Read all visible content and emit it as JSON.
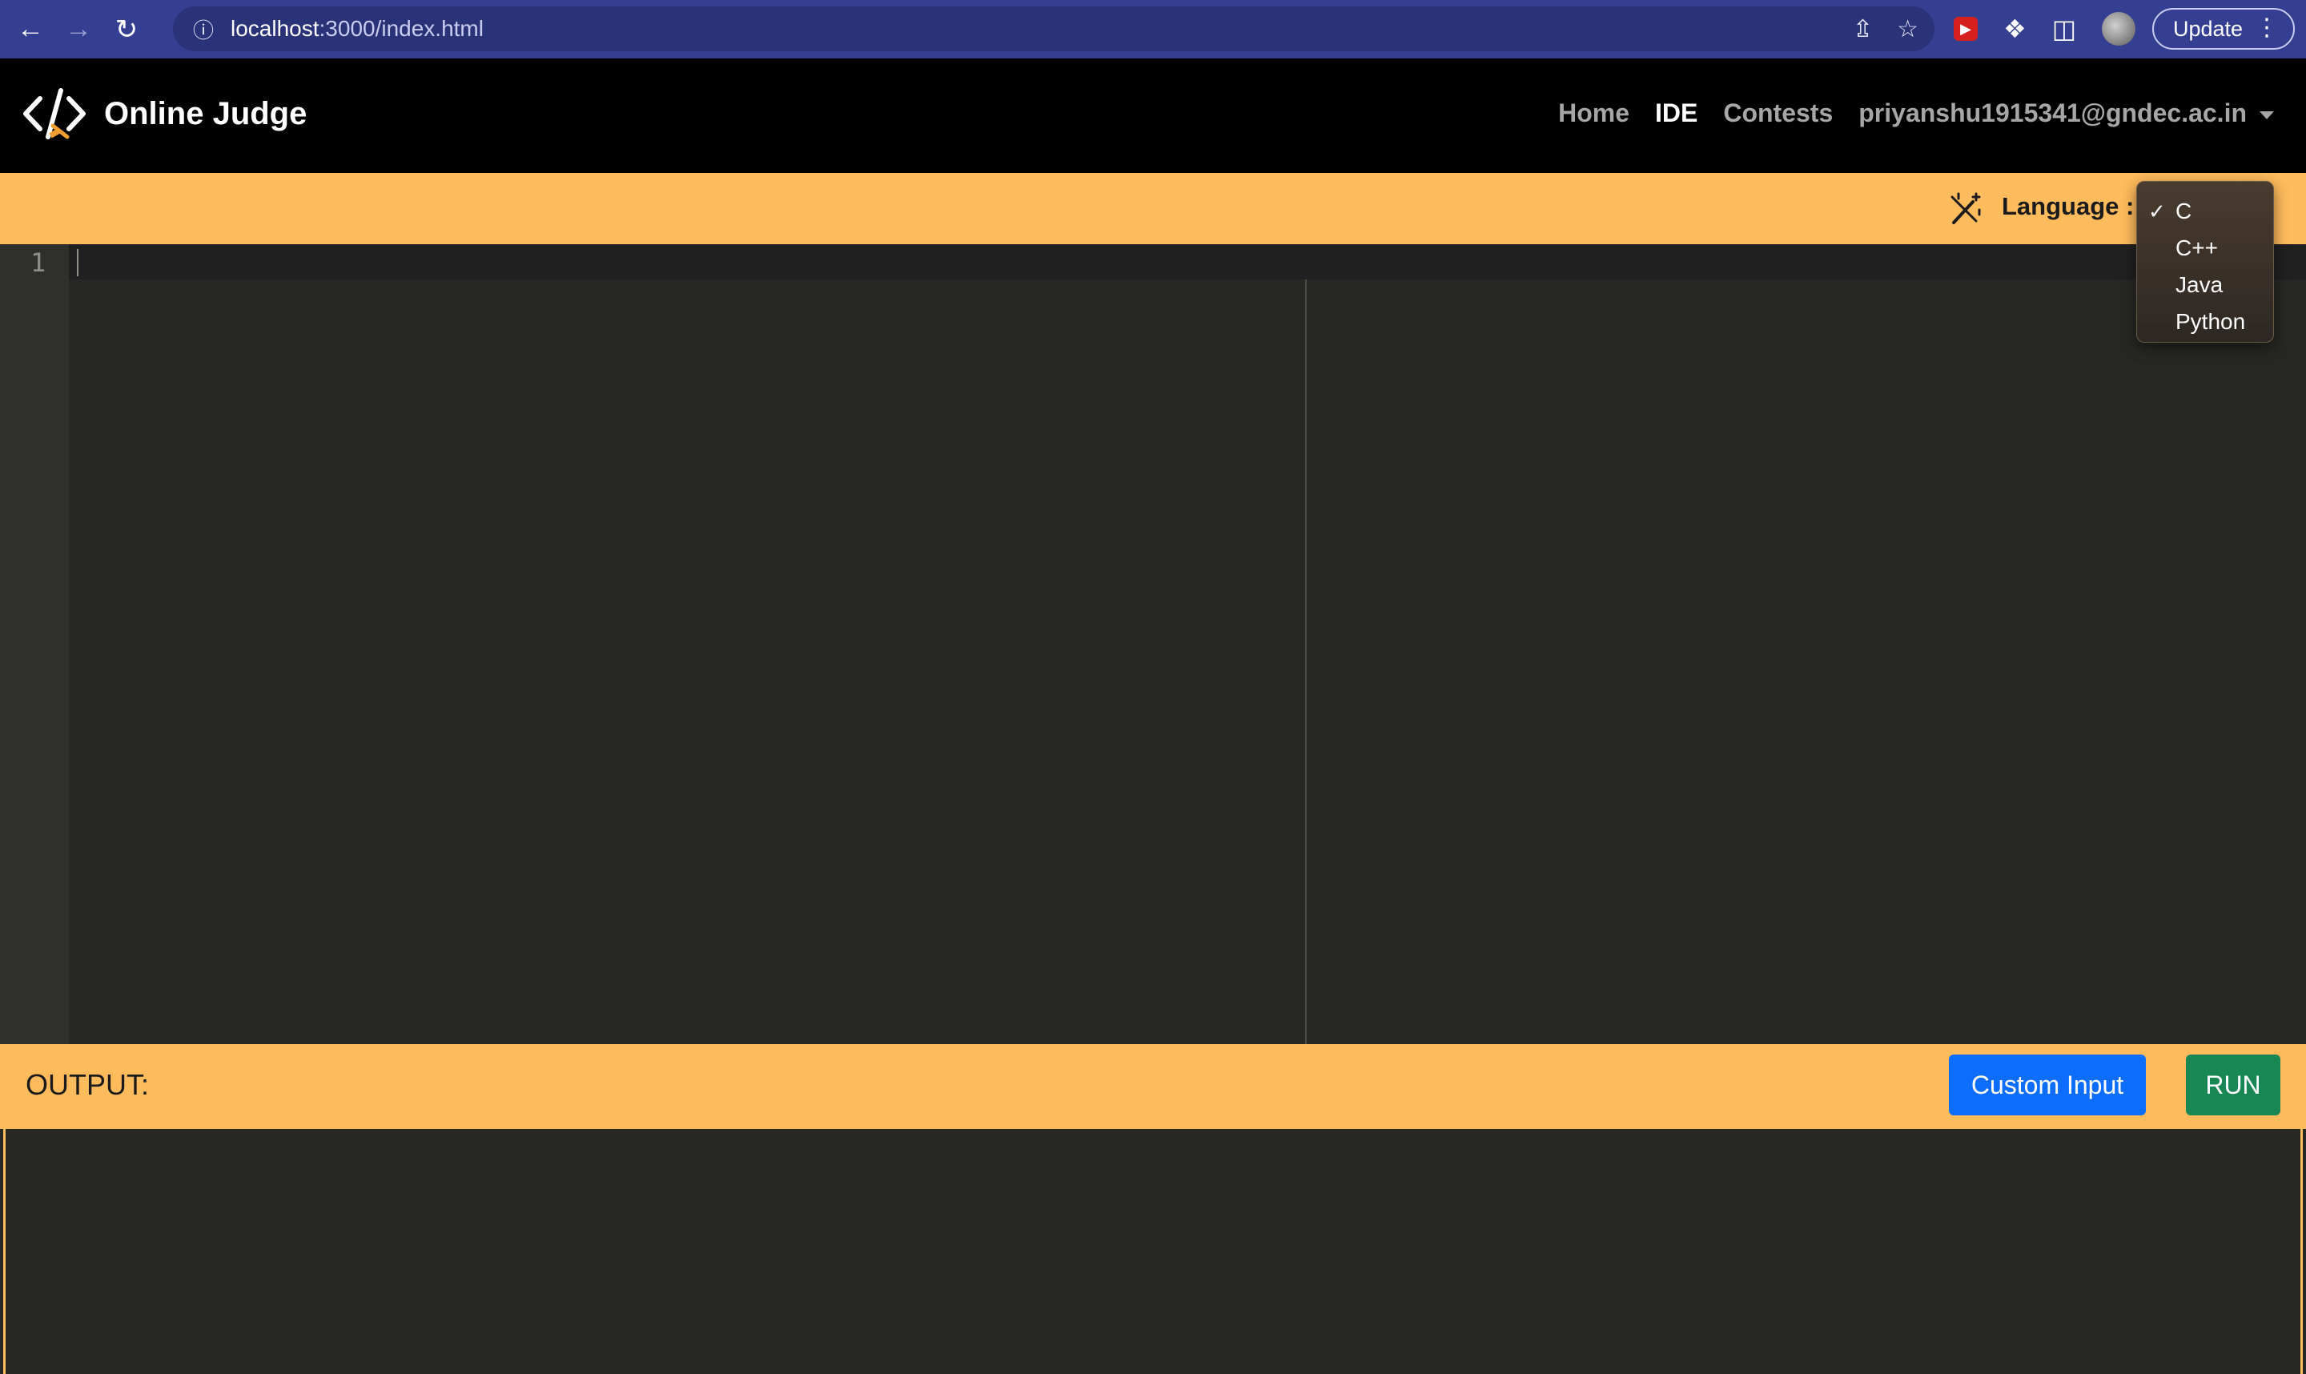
{
  "browser": {
    "url_host": "localhost",
    "url_path": ":3000/index.html",
    "update_label": "Update",
    "icons": [
      "back-icon",
      "forward-icon",
      "reload-icon",
      "site-info-icon",
      "share-icon",
      "bookmark-star-icon",
      "extension-red-icon",
      "puzzle-extensions-icon",
      "side-panel-icon",
      "profile-avatar",
      "menu-dots-icon"
    ]
  },
  "navbar": {
    "brand": "Online Judge",
    "links": {
      "home": "Home",
      "ide": "IDE",
      "contests": "Contests"
    },
    "user": "priyanshu1915341@gndec.ac.in",
    "active_link": "IDE"
  },
  "toolbar": {
    "language_label": "Language :",
    "icon": "magic-wand-icon"
  },
  "language_dropdown": {
    "selected": "C",
    "options": [
      "C",
      "C++",
      "Java",
      "Python"
    ]
  },
  "editor": {
    "line_numbers": [
      "1"
    ],
    "content": ""
  },
  "output": {
    "label": "OUTPUT:",
    "custom_input_label": "Custom Input",
    "run_label": "RUN",
    "text": ""
  },
  "colors": {
    "accent_bar": "#ffbb5c",
    "editor_bg": "#272723",
    "custom_input_button": "#0d6efd",
    "run_button": "#198754",
    "browser_chrome": "#353f92"
  }
}
